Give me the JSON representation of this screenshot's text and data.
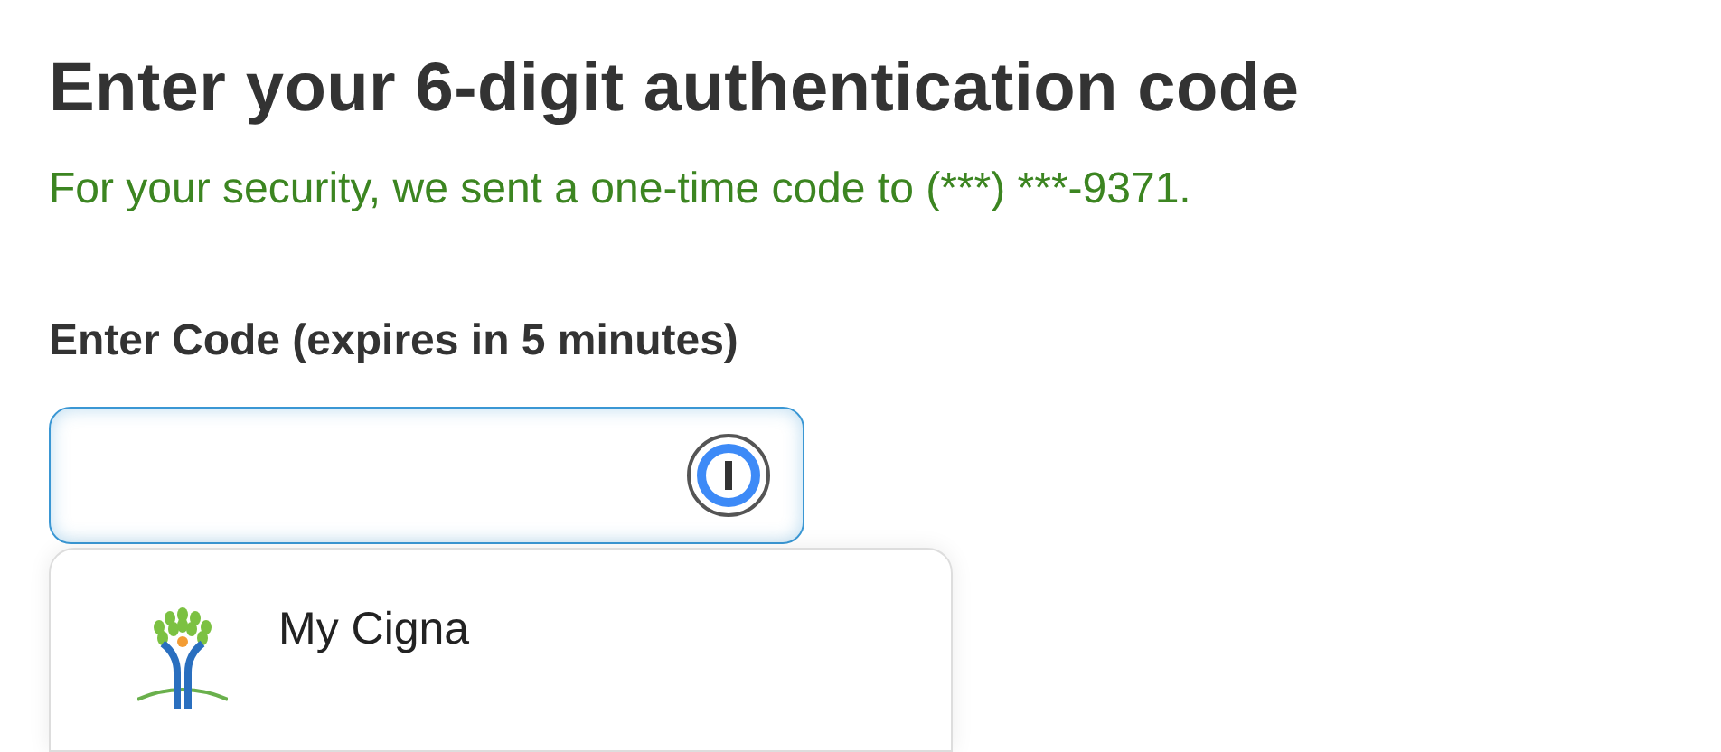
{
  "heading": "Enter your 6-digit authentication code",
  "message": "For your security, we sent a one-time code to (***) ***-9371.",
  "code_field": {
    "label": "Enter Code (expires in 5 minutes)",
    "focused": true
  },
  "suggestions": [
    {
      "title": "My Cigna"
    }
  ]
}
